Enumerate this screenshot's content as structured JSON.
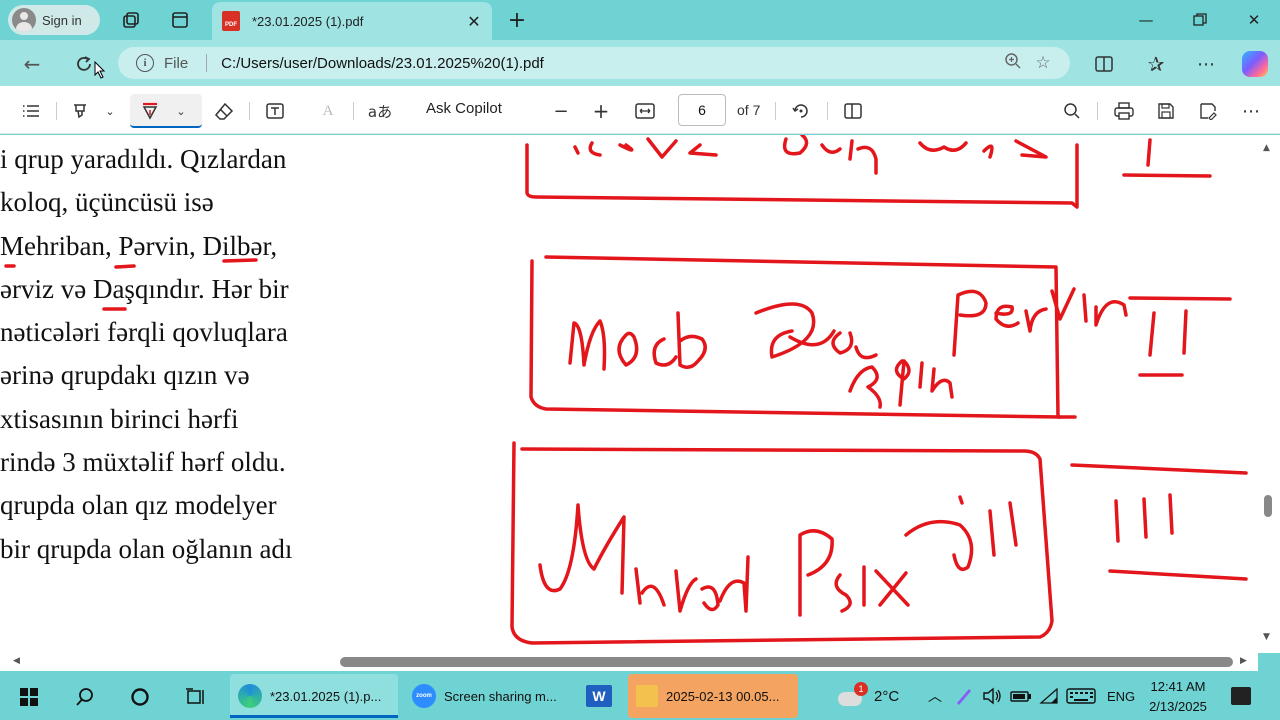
{
  "browser": {
    "signin_label": "Sign in",
    "tab_title": "*23.01.2025 (1).pdf",
    "pdf_badge": "PDF",
    "url_prefix": "File",
    "url": "C:/Users/user/Downloads/23.01.2025%20(1).pdf"
  },
  "pdf_toolbar": {
    "ask_copilot": "Ask Copilot",
    "read_aloud_glyph": "aあ",
    "current_page": "6",
    "page_count_label": "of 7"
  },
  "document": {
    "lines": [
      "i qrup yaradıldı. Qızlardan",
      "koloq, üçüncüsü isə",
      "Mehriban, Pərvin, Dilbər,",
      "ərviz və Daşqındır. Hər bir",
      " nəticələri fərqli qovluqlara",
      "ərinə qrupdakı qızın və",
      "xtisasının birinci hərfi",
      "rində 3 müxtəlif hərf oldu.",
      " qrupda olan qız modelyer",
      " bir qrupda olan oğlanın adı"
    ],
    "handwriting": {
      "row1": "Təbriz əl Dəvz",
      "row1_num": "I",
      "row2_a": "Mod",
      "row2_b": "Daşqın",
      "row2_c": "Pərvin",
      "row2_num": "II",
      "row3_a": "Murad",
      "row3_b": "Psix",
      "row3_c": "Dil",
      "row3_num": "III"
    }
  },
  "taskbar": {
    "apps": [
      {
        "label": "*23.01.2025 (1).p..."
      },
      {
        "label": "Screen sharing m..."
      },
      {
        "label": "W"
      },
      {
        "label": "2025-02-13 00.05..."
      }
    ],
    "weather_temp": "2°C",
    "weather_badge": "1",
    "language": "ENG",
    "time": "12:41 AM",
    "date": "2/13/2025",
    "zoom_icon_text": "zoom"
  },
  "colors": {
    "accent": "#0067c0",
    "ink_red": "#e3161b",
    "chrome_teal": "#6fd3d3"
  }
}
